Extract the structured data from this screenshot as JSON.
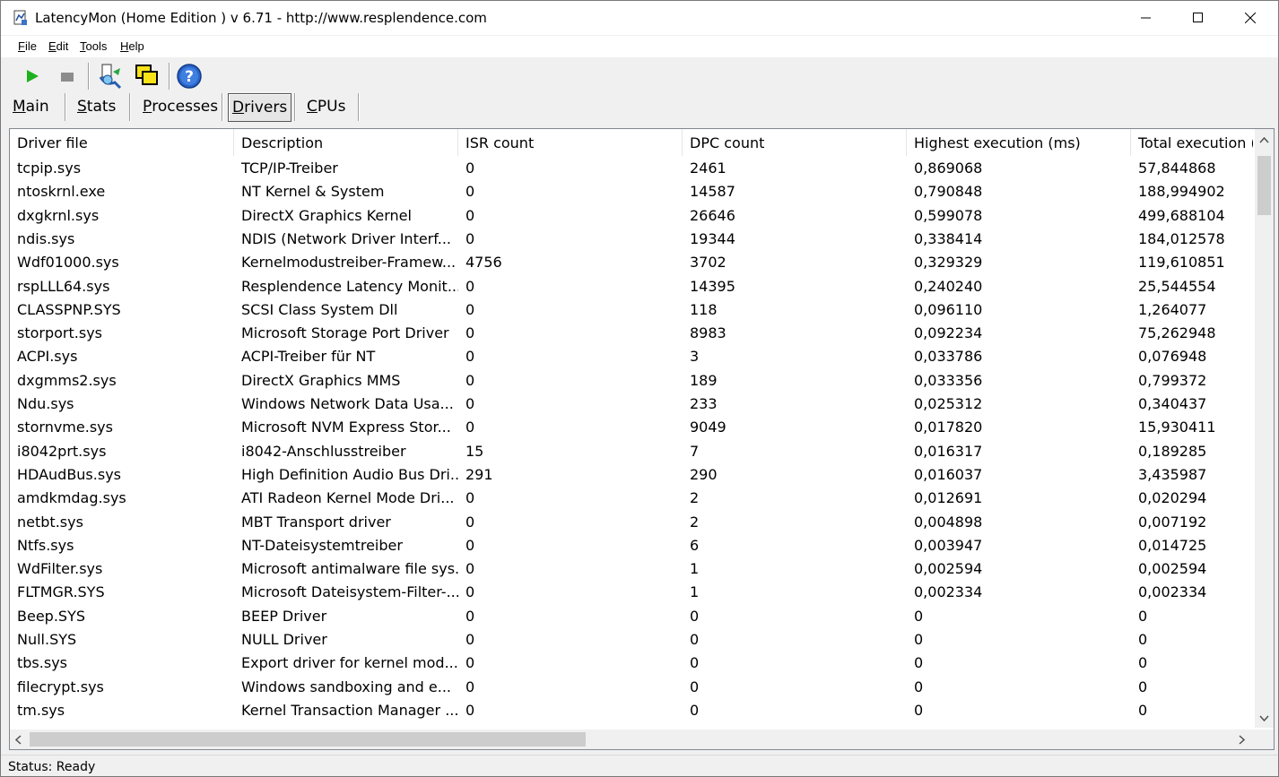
{
  "window": {
    "title": "LatencyMon  (Home Edition )  v 6.71 - http://www.resplendence.com"
  },
  "menu": [
    {
      "key": "F",
      "rest": "ile"
    },
    {
      "key": "E",
      "rest": "dit"
    },
    {
      "key": "T",
      "rest": "ools"
    },
    {
      "key": "H",
      "rest": "elp"
    }
  ],
  "toolbar": {
    "buttons": [
      "play-icon",
      "stop-icon",
      "driver-wizard-icon",
      "windows-icon",
      "help-icon"
    ]
  },
  "tabs": [
    {
      "key": "M",
      "rest": "ain",
      "active": false
    },
    {
      "key": "S",
      "rest": "tats",
      "active": false
    },
    {
      "key": "P",
      "rest": "rocesses",
      "active": false
    },
    {
      "key": "D",
      "rest": "rivers",
      "active": true
    },
    {
      "key": "C",
      "rest": "PUs",
      "active": false
    }
  ],
  "table": {
    "columns": [
      "Driver file",
      "Description",
      "ISR count",
      "DPC count",
      "Highest execution (ms)",
      "Total execution (ms)"
    ],
    "rows": [
      [
        "tcpip.sys",
        "TCP/IP-Treiber",
        "0",
        "2461",
        "0,869068",
        "57,844868"
      ],
      [
        "ntoskrnl.exe",
        "NT Kernel & System",
        "0",
        "14587",
        "0,790848",
        "188,994902"
      ],
      [
        "dxgkrnl.sys",
        "DirectX Graphics Kernel",
        "0",
        "26646",
        "0,599078",
        "499,688104"
      ],
      [
        "ndis.sys",
        "NDIS (Network Driver Interf...",
        "0",
        "19344",
        "0,338414",
        "184,012578"
      ],
      [
        "Wdf01000.sys",
        "Kernelmodustreiber-Framew...",
        "4756",
        "3702",
        "0,329329",
        "119,610851"
      ],
      [
        "rspLLL64.sys",
        "Resplendence Latency Monit...",
        "0",
        "14395",
        "0,240240",
        "25,544554"
      ],
      [
        "CLASSPNP.SYS",
        "SCSI Class System Dll",
        "0",
        "118",
        "0,096110",
        "1,264077"
      ],
      [
        "storport.sys",
        "Microsoft Storage Port Driver",
        "0",
        "8983",
        "0,092234",
        "75,262948"
      ],
      [
        "ACPI.sys",
        "ACPI-Treiber für NT",
        "0",
        "3",
        "0,033786",
        "0,076948"
      ],
      [
        "dxgmms2.sys",
        "DirectX Graphics MMS",
        "0",
        "189",
        "0,033356",
        "0,799372"
      ],
      [
        "Ndu.sys",
        "Windows Network Data Usa...",
        "0",
        "233",
        "0,025312",
        "0,340437"
      ],
      [
        "stornvme.sys",
        "Microsoft NVM Express Stor...",
        "0",
        "9049",
        "0,017820",
        "15,930411"
      ],
      [
        "i8042prt.sys",
        "i8042-Anschlusstreiber",
        "15",
        "7",
        "0,016317",
        "0,189285"
      ],
      [
        "HDAudBus.sys",
        "High Definition Audio Bus Dri...",
        "291",
        "290",
        "0,016037",
        "3,435987"
      ],
      [
        "amdkmdag.sys",
        "ATI Radeon Kernel Mode Dri...",
        "0",
        "2",
        "0,012691",
        "0,020294"
      ],
      [
        "netbt.sys",
        "MBT Transport driver",
        "0",
        "2",
        "0,004898",
        "0,007192"
      ],
      [
        "Ntfs.sys",
        "NT-Dateisystemtreiber",
        "0",
        "6",
        "0,003947",
        "0,014725"
      ],
      [
        "WdFilter.sys",
        "Microsoft antimalware file sys...",
        "0",
        "1",
        "0,002594",
        "0,002594"
      ],
      [
        "FLTMGR.SYS",
        "Microsoft Dateisystem-Filter-...",
        "0",
        "1",
        "0,002334",
        "0,002334"
      ],
      [
        "Beep.SYS",
        "BEEP Driver",
        "0",
        "0",
        "0",
        "0"
      ],
      [
        "Null.SYS",
        "NULL Driver",
        "0",
        "0",
        "0",
        "0"
      ],
      [
        "tbs.sys",
        "Export driver for kernel mod...",
        "0",
        "0",
        "0",
        "0"
      ],
      [
        "filecrypt.sys",
        "Windows sandboxing and e...",
        "0",
        "0",
        "0",
        "0"
      ],
      [
        "tm.sys",
        "Kernel Transaction Manager ...",
        "0",
        "0",
        "0",
        "0"
      ]
    ]
  },
  "status": {
    "text": "Status: Ready"
  }
}
